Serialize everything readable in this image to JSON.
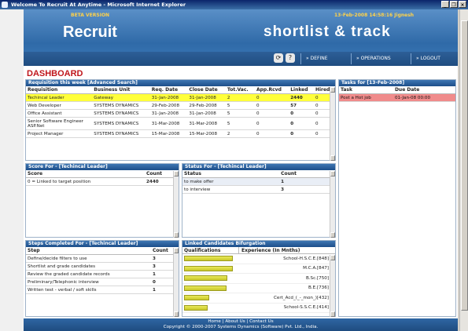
{
  "window": {
    "title": "Welcome To Recruit At Anytime - Microsoft Internet Explorer",
    "min": "_",
    "max": "❐",
    "close": "×"
  },
  "banner": {
    "beta": "BETA VERSION",
    "date_user": "13-Feb-2008 14:58:16  Jignesh",
    "brand": "Recruit",
    "tagline": "shortlist & track"
  },
  "nav": {
    "define": "» DEFINE",
    "operations": "» OPERATIONS",
    "logout": "» LOGOUT"
  },
  "dashboard": {
    "title": "DASHBOARD"
  },
  "requisition": {
    "header": "Requisition this week [Advanced Search]",
    "columns": [
      "Requisition",
      "Business Unit",
      "Req. Date",
      "Close Date",
      "Tot.Vac.",
      "App.Rcvd",
      "Linked",
      "Hired"
    ],
    "rows": [
      [
        "Techincal Leader",
        "Gateway",
        "31-Jan-2008",
        "31-Jan-2008",
        "2",
        "0",
        "2440",
        "0"
      ],
      [
        "Web Developer",
        "SYSTEMS DYNAMICS",
        "29-Feb-2008",
        "29-Feb-2008",
        "5",
        "0",
        "57",
        "0"
      ],
      [
        "Office Assistant",
        "SYSTEMS DYNAMICS",
        "31-Jan-2008",
        "31-Jan-2008",
        "5",
        "0",
        "0",
        "0"
      ],
      [
        "Senior Software Engineer ASP.Net",
        "SYSTEMS DYNAMICS",
        "31-Mar-2008",
        "31-Mar-2008",
        "5",
        "0",
        "0",
        "0"
      ],
      [
        "Project Manager",
        "SYSTEMS DYNAMICS",
        "15-Mar-2008",
        "15-Mar-2008",
        "2",
        "0",
        "0",
        "0"
      ]
    ]
  },
  "tasks": {
    "header": "Tasks for [13-Feb-2008]",
    "columns": [
      "Task",
      "Due Date"
    ],
    "rows": [
      [
        "Post a Hot job",
        "01-Jan-08 00:00"
      ]
    ]
  },
  "score": {
    "header": "Score For - [Techincal Leader]",
    "columns": [
      "Score",
      "Count"
    ],
    "rows": [
      [
        "0 = Linked to target position",
        "2440"
      ]
    ]
  },
  "status": {
    "header": "Status For - [Techincal Leader]",
    "columns": [
      "Status",
      "Count"
    ],
    "rows": [
      [
        "to make offer",
        "1"
      ],
      [
        "to interview",
        "3"
      ]
    ]
  },
  "steps": {
    "header": "Steps Completed For - [Techincal Leader]",
    "columns": [
      "Step",
      "Count"
    ],
    "rows": [
      [
        "Define/decide filters to use",
        "3"
      ],
      [
        "Shortlist and grade candidates",
        "3"
      ],
      [
        "Review the graded candidate records",
        "1"
      ],
      [
        "Preliminary/Telephonic interview",
        "0"
      ],
      [
        "Written test - verbal / soft skills",
        "1"
      ]
    ]
  },
  "bifurcation": {
    "header": "Linked Candidates Bifurgation",
    "tab_qualifications": "Qualifications",
    "tab_experience": "Experience (In Mnths)",
    "bars": [
      {
        "label": "School-H.S.C.E.[848]",
        "value": 848
      },
      {
        "label": "M.C.A.[847]",
        "value": 847
      },
      {
        "label": "B.Sc.[750]",
        "value": 750
      },
      {
        "label": "B.E.[736]",
        "value": 736
      },
      {
        "label": "Cert_Acd_(_-_mon_)[432]",
        "value": 432
      },
      {
        "label": "School-S.S.C.E.[414]",
        "value": 414
      }
    ]
  },
  "footer": {
    "links": [
      "Home",
      "About Us",
      "Contact Us"
    ],
    "copyright": "Copyright © 2000-2007 Systems Dynamics (Software) Pvt. Ltd., India."
  },
  "colors": {
    "accent_red": "#c0161b",
    "banner_blue": "#2f6aa8",
    "selected_row": "#ffff3a",
    "task_red": "#f08b8b"
  }
}
